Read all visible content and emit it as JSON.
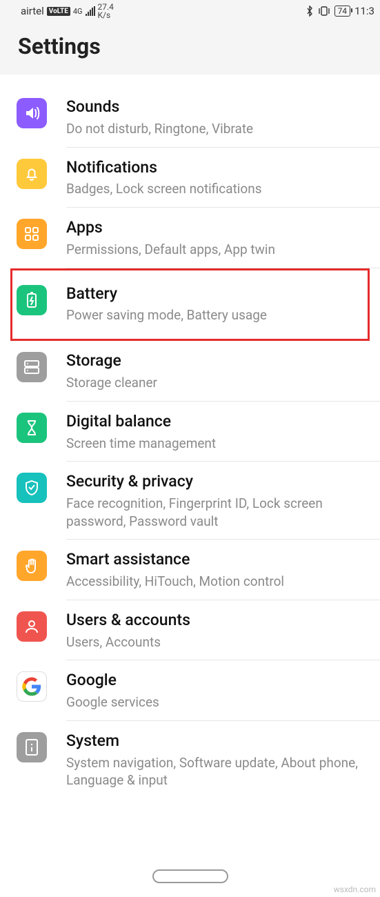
{
  "statusbar": {
    "carrier": "airtel",
    "volte": "VoLTE",
    "net": "4G",
    "speed_top": "27.4",
    "speed_unit": "K/s",
    "battery": "74",
    "time": "11:3"
  },
  "header": {
    "title": "Settings"
  },
  "items": [
    {
      "title": "Sounds",
      "sub": "Do not disturb, Ringtone, Vibrate"
    },
    {
      "title": "Notifications",
      "sub": "Badges, Lock screen notifications"
    },
    {
      "title": "Apps",
      "sub": "Permissions, Default apps, App twin"
    },
    {
      "title": "Battery",
      "sub": "Power saving mode, Battery usage"
    },
    {
      "title": "Storage",
      "sub": "Storage cleaner"
    },
    {
      "title": "Digital balance",
      "sub": "Screen time management"
    },
    {
      "title": "Security & privacy",
      "sub": "Face recognition, Fingerprint ID, Lock screen password, Password vault"
    },
    {
      "title": "Smart assistance",
      "sub": "Accessibility, HiTouch, Motion control"
    },
    {
      "title": "Users & accounts",
      "sub": "Users, Accounts"
    },
    {
      "title": "Google",
      "sub": "Google services"
    },
    {
      "title": "System",
      "sub": "System navigation, Software update, About phone, Language & input"
    }
  ],
  "watermark": "wsxdn.com"
}
